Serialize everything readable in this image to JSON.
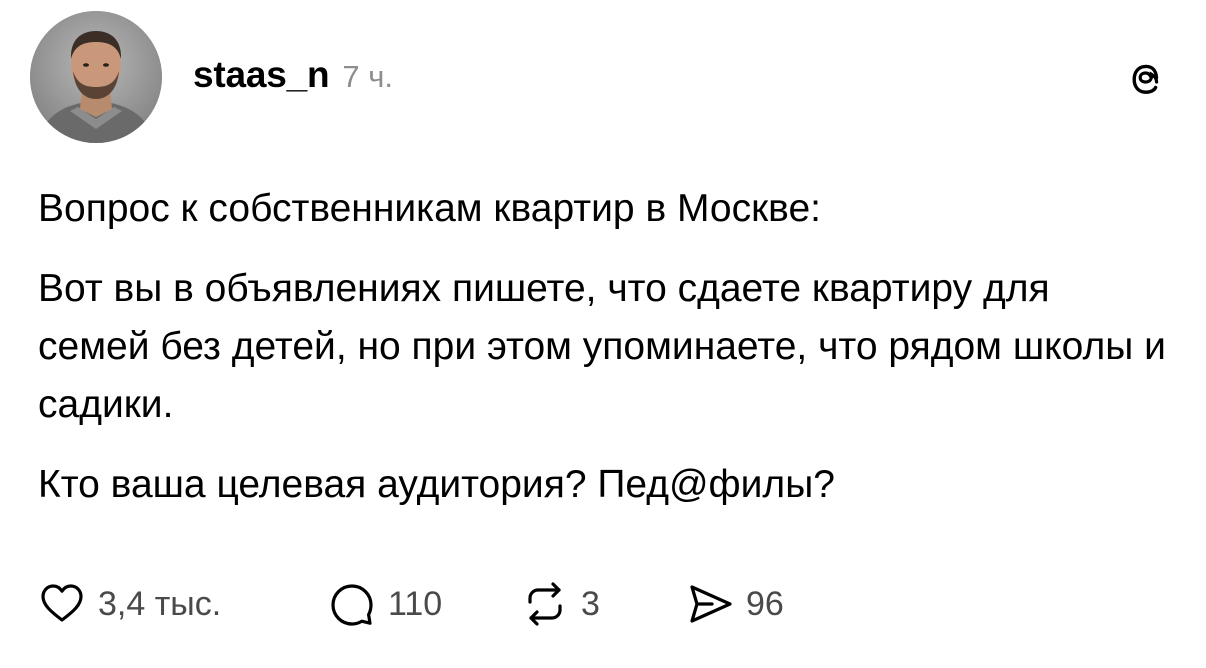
{
  "post": {
    "author": {
      "username": "staas_n",
      "time_ago": "7 ч."
    },
    "paragraphs": [
      "Вопрос к собственникам квартир в Москве:",
      "Вот вы в объявлениях пишете, что сдаете квартиру для семей без детей, но при этом упоминаете, что рядом школы и садики.",
      "Кто ваша целевая аудитория? Пед@филы?"
    ],
    "actions": {
      "likes": "3,4 тыс.",
      "comments": "110",
      "reposts": "3",
      "shares": "96"
    }
  },
  "icons": {
    "brand": "threads-logo-icon",
    "like": "heart-icon",
    "comment": "comment-bubble-icon",
    "repost": "repost-arrows-icon",
    "share": "send-arrow-icon"
  }
}
